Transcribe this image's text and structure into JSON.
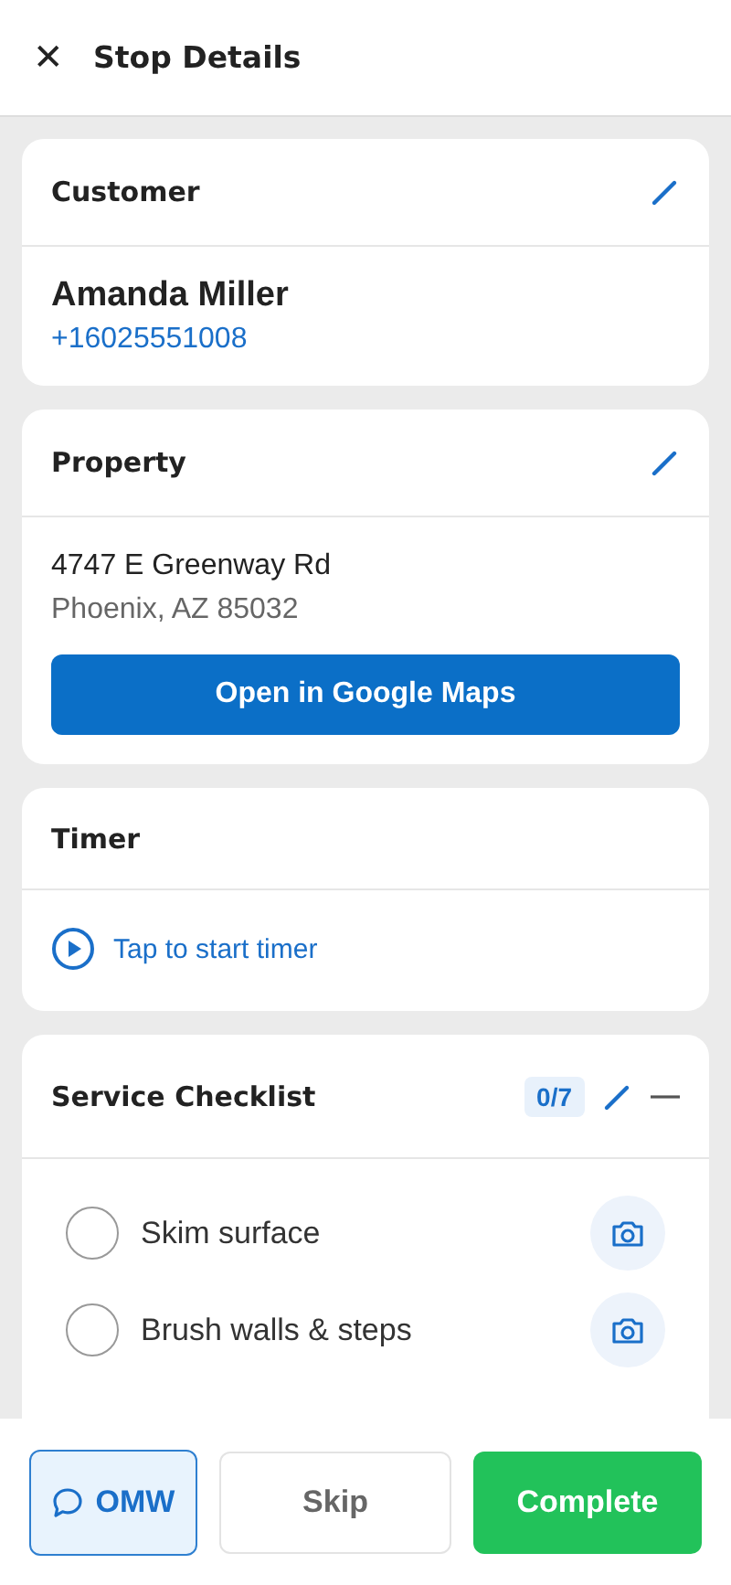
{
  "header": {
    "close_icon": "✕",
    "title": "Stop Details"
  },
  "customer": {
    "title": "Customer",
    "name": "Amanda Miller",
    "phone": "+16025551008"
  },
  "property": {
    "title": "Property",
    "address_line_1": "4747 E Greenway Rd",
    "address_line_2": "Phoenix, AZ 85032",
    "button": "Open in Google Maps"
  },
  "timer": {
    "title": "Timer",
    "action": "Tap to start timer"
  },
  "checklist": {
    "title": "Service Checklist",
    "count": "0/7",
    "expanded": true,
    "items": [
      {
        "label": "Skim surface",
        "checked": false
      },
      {
        "label": "Brush walls & steps",
        "checked": false
      }
    ]
  },
  "footer_buttons": [
    {
      "kind": "outline",
      "label": "OMW"
    },
    {
      "kind": "plain",
      "label": "Skip"
    },
    {
      "kind": "primary",
      "label": "Complete"
    }
  ]
}
